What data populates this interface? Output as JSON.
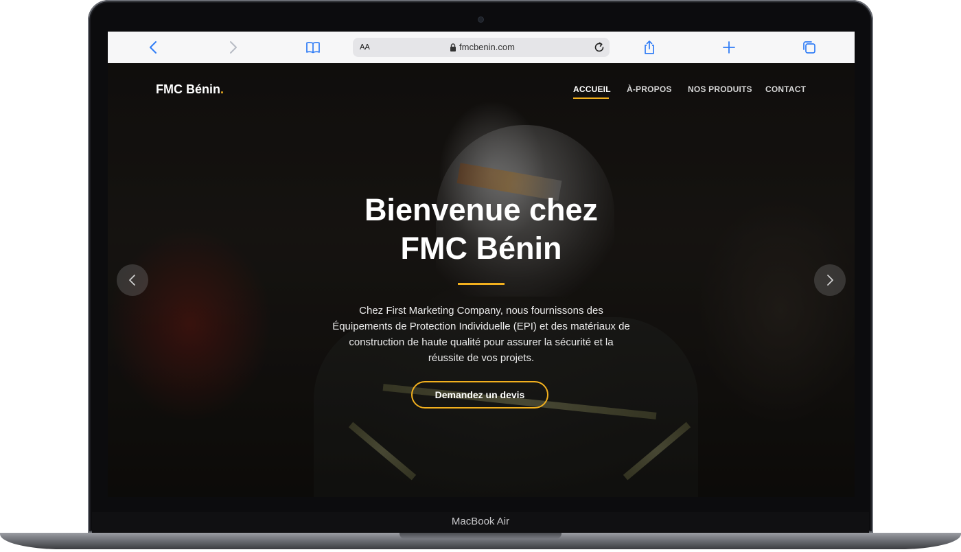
{
  "device": {
    "model_label": "MacBook Air"
  },
  "browser": {
    "text_size_label": "AA",
    "url": "fmcbenin.com",
    "icons": {
      "back": "chevron-left-icon",
      "forward": "chevron-right-icon",
      "bookmarks": "book-icon",
      "lock": "lock-icon",
      "reload": "reload-icon",
      "share": "share-icon",
      "new_tab": "plus-icon",
      "tabs": "tabs-icon"
    },
    "accent_color": "#2f7cf6"
  },
  "site": {
    "logo": {
      "name": "FMC Bénin",
      "dot": "."
    },
    "nav": [
      {
        "label": "ACCUEIL",
        "active": true
      },
      {
        "label": "À-PROPOS",
        "active": false
      },
      {
        "label": "NOS PRODUITS",
        "active": false
      },
      {
        "label": "CONTACT",
        "active": false
      }
    ],
    "hero": {
      "title_line1": "Bienvenue chez",
      "title_line2": "FMC Bénin",
      "description_lines": [
        "Chez First Marketing Company, nous fournissons des",
        "Équipements de Protection Individuelle (EPI) et des matériaux de",
        "construction de haute qualité pour assurer la sécurité et la",
        "réussite de vos projets."
      ],
      "cta_label": "Demandez un devis",
      "carousel_icons": {
        "prev": "chevron-left-icon",
        "next": "chevron-right-icon"
      }
    },
    "accent_color": "#f2b01e"
  }
}
